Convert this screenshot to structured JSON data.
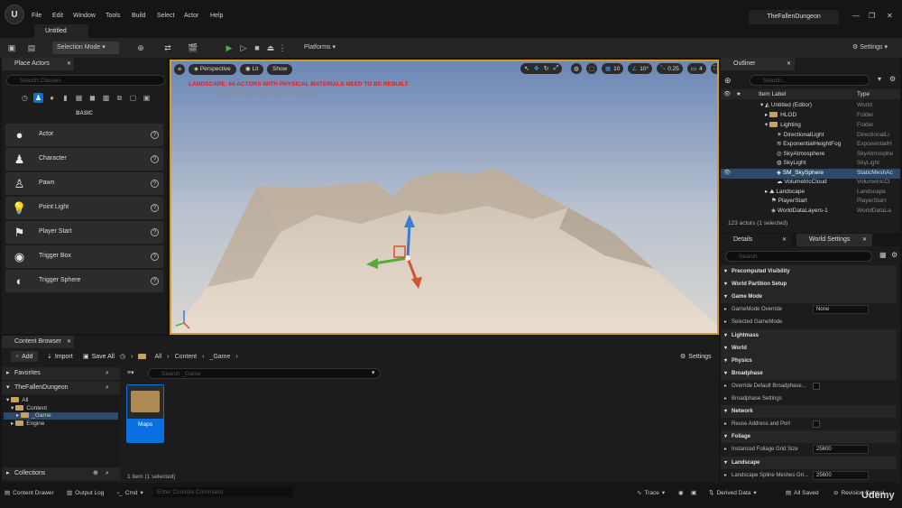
{
  "menu": {
    "logo": "U",
    "items": [
      "File",
      "Edit",
      "Window",
      "Tools",
      "Build",
      "Select",
      "Actor",
      "Help"
    ],
    "level_tab": "Untitled",
    "project": "TheFallenDungeon"
  },
  "toolbar": {
    "selection_mode": "Selection Mode",
    "platforms": "Platforms",
    "settings": "Settings"
  },
  "place_actors": {
    "tab": "Place Actors",
    "search_placeholder": "Search Classes",
    "category": "BASIC",
    "actors": [
      "Actor",
      "Character",
      "Pawn",
      "Point Light",
      "Player Start",
      "Trigger Box",
      "Trigger Sphere"
    ]
  },
  "viewport": {
    "perspective": "Perspective",
    "lit": "Lit",
    "show": "Show",
    "warning": "LANDSCAPE: 64 ACTORS WITH PHYSICAL MATERIALS NEED TO BE REBUILT",
    "suppress_hint": "DisableAllScreenMessages to suppress",
    "grid_snap": "10",
    "rot_snap": "10°",
    "scale_snap": "0.25",
    "cam_speed": "4"
  },
  "outliner": {
    "tab": "Outliner",
    "search_placeholder": "Search...",
    "col_label": "Item Label",
    "col_type": "Type",
    "rows": [
      {
        "name": "Untitled (Editor)",
        "type": "World"
      },
      {
        "name": "HLOD",
        "type": "Folder"
      },
      {
        "name": "Lighting",
        "type": "Folder"
      },
      {
        "name": "DirectionalLight",
        "type": "DirectionalLi"
      },
      {
        "name": "ExponentialHeightFog",
        "type": "ExponentialH"
      },
      {
        "name": "SkyAtmosphere",
        "type": "SkyAtmosphe"
      },
      {
        "name": "SkyLight",
        "type": "SkyLight"
      },
      {
        "name": "SM_SkySphere",
        "type": "StaticMeshAc"
      },
      {
        "name": "VolumetricCloud",
        "type": "VolumetricCl"
      },
      {
        "name": "Landscape",
        "type": "Landscape"
      },
      {
        "name": "PlayerStart",
        "type": "PlayerStart"
      },
      {
        "name": "WorldDataLayers-1",
        "type": "WorldDataLa"
      }
    ],
    "status": "123 actors (1 selected)"
  },
  "details": {
    "tab_details": "Details",
    "tab_world": "World Settings",
    "search_placeholder": "Search",
    "rows": [
      {
        "kind": "cat",
        "label": "Precomputed Visibility"
      },
      {
        "kind": "cat",
        "label": "World Partition Setup"
      },
      {
        "kind": "cat",
        "label": "Game Mode"
      },
      {
        "kind": "prop",
        "label": "GameMode Override",
        "value": "None"
      },
      {
        "kind": "prop",
        "label": "Selected GameMode"
      },
      {
        "kind": "cat",
        "label": "Lightmass"
      },
      {
        "kind": "cat",
        "label": "World"
      },
      {
        "kind": "cat",
        "label": "Physics"
      },
      {
        "kind": "cat",
        "label": "Broadphase"
      },
      {
        "kind": "prop",
        "label": "Override Default Broadphase...",
        "check": true
      },
      {
        "kind": "prop",
        "label": "Broadphase Settings"
      },
      {
        "kind": "cat",
        "label": "Network"
      },
      {
        "kind": "prop",
        "label": "Reuse Address and Port",
        "check": true
      },
      {
        "kind": "cat",
        "label": "Foliage"
      },
      {
        "kind": "prop",
        "label": "Instanced Foliage Grid Size",
        "value": "25600"
      },
      {
        "kind": "cat",
        "label": "Landscape"
      },
      {
        "kind": "prop",
        "label": "Landscape Spline Meshes Gri...",
        "value": "25600"
      }
    ]
  },
  "content_browser": {
    "tab": "Content Browser",
    "add": "Add",
    "import": "Import",
    "save_all": "Save All",
    "path": [
      "All",
      "Content",
      "_Game"
    ],
    "settings": "Settings",
    "favorites": "Favorites",
    "project": "TheFallenDungeon",
    "tree": [
      "All",
      "Content",
      "_Game",
      "Engine"
    ],
    "collections": "Collections",
    "search_placeholder": "Search _Game",
    "folder_name": "Maps",
    "status": "1 item (1 selected)"
  },
  "statusbar": {
    "content_drawer": "Content Drawer",
    "output_log": "Output Log",
    "cmd": "Cmd",
    "console_placeholder": "Enter Console Command",
    "trace": "Trace",
    "derived_data": "Derived Data",
    "all_saved": "All Saved",
    "revision_control": "Revision Control"
  },
  "watermark": "Udemy",
  "colors": {
    "accent_orange": "#d89b22",
    "selection_blue": "#0a6fe0",
    "play_green": "#4caf50"
  }
}
